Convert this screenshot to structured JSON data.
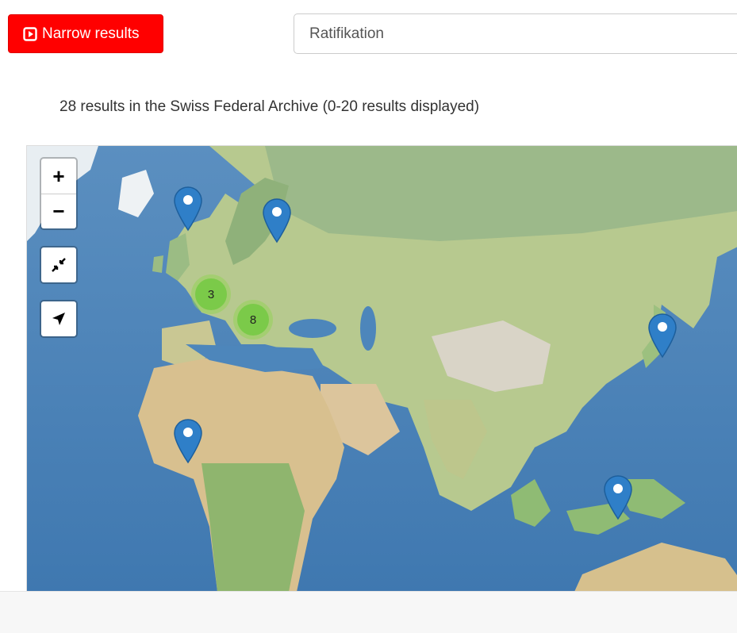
{
  "toolbar": {
    "narrow_label": "Narrow results",
    "search_value": "Ratifikation"
  },
  "summary": "28 results in the Swiss Federal Archive (0-20 results displayed)",
  "map": {
    "controls": {
      "zoom_in": "+",
      "zoom_out": "−"
    },
    "clusters": [
      "3",
      "8"
    ],
    "marker_count": 5
  },
  "colors": {
    "narrow_button": "#ff0000",
    "marker": "#2f7fc8",
    "cluster": "#7cc94a"
  }
}
